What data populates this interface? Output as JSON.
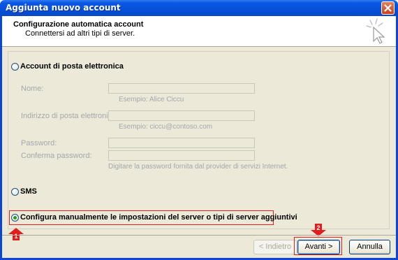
{
  "window": {
    "title": "Aggiunta nuovo account"
  },
  "header": {
    "title": "Configurazione automatica account",
    "subtitle": "Connettersi ad altri tipi di server."
  },
  "options": {
    "email_account": "Account di posta elettronica",
    "sms": "SMS",
    "manual": "Configura manualmente le impostazioni del server o tipi di server aggiuntivi",
    "selected": "manual"
  },
  "form": {
    "name_label": "Nome:",
    "name_hint": "Esempio: Alice Ciccu",
    "email_label": "Indirizzo di posta elettronica:",
    "email_hint": "Esempio: ciccu@contoso.com",
    "password_label": "Password:",
    "confirm_label": "Conferma password:",
    "password_hint": "Digitare la password fornita dal provider di servizi Internet."
  },
  "markers": {
    "one": "1",
    "two": "2"
  },
  "buttons": {
    "back": "< Indietro",
    "next": "Avanti >",
    "cancel": "Annulla"
  },
  "colors": {
    "titlebar": "#0a58e0",
    "dialog_bg": "#ece9d8",
    "highlight": "#e31d1d"
  }
}
